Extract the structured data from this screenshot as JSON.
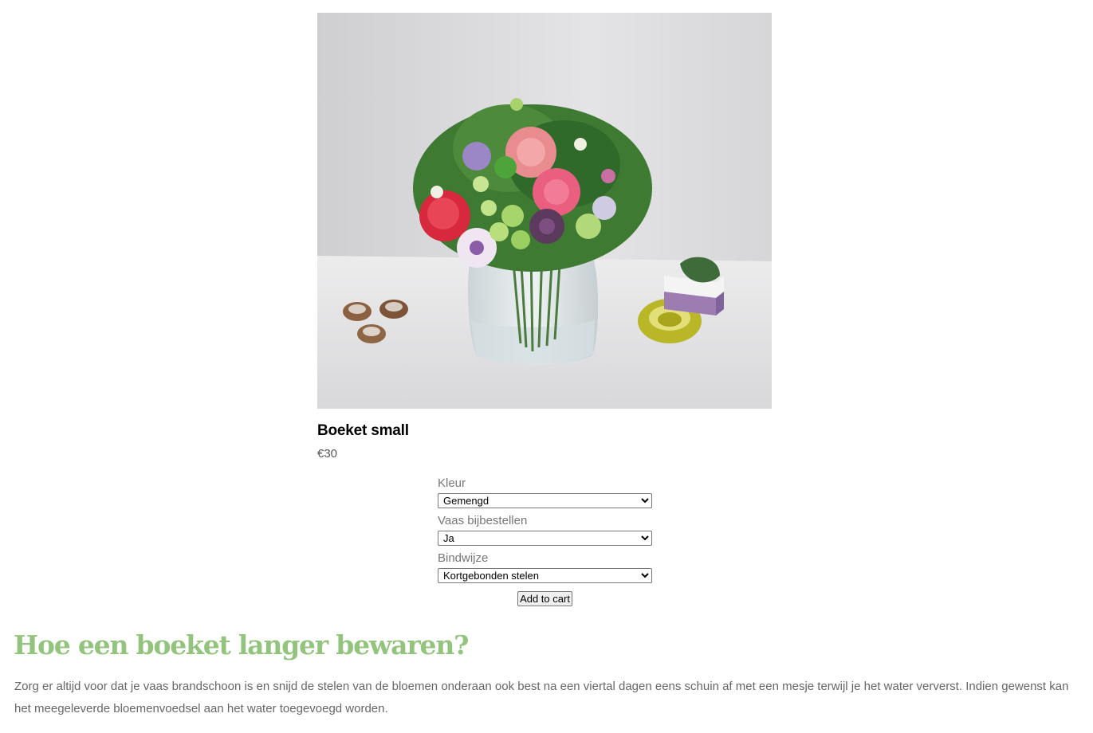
{
  "product": {
    "image_alt": "Boeket small",
    "title": "Boeket small",
    "price": "€30"
  },
  "options": [
    {
      "label": "Kleur",
      "selected": "Gemengd"
    },
    {
      "label": "Vaas bijbestellen",
      "selected": "Ja"
    },
    {
      "label": "Bindwijze",
      "selected": "Kortgebonden stelen"
    }
  ],
  "cart": {
    "button_label": "Add to cart"
  },
  "info": {
    "heading": "Hoe een boeket langer bewaren?",
    "text": "Zorg er altijd voor dat je vaas brandschoon is en snijd de stelen van de bloemen onderaan ook best na een viertal dagen eens schuin af met een mesje terwijl je het water ververst. Indien gewenst kan het meegeleverde bloemenvoedsel aan het water toegevoegd worden."
  },
  "colors": {
    "heading_green": "#93c47d",
    "body_text": "#666666"
  }
}
